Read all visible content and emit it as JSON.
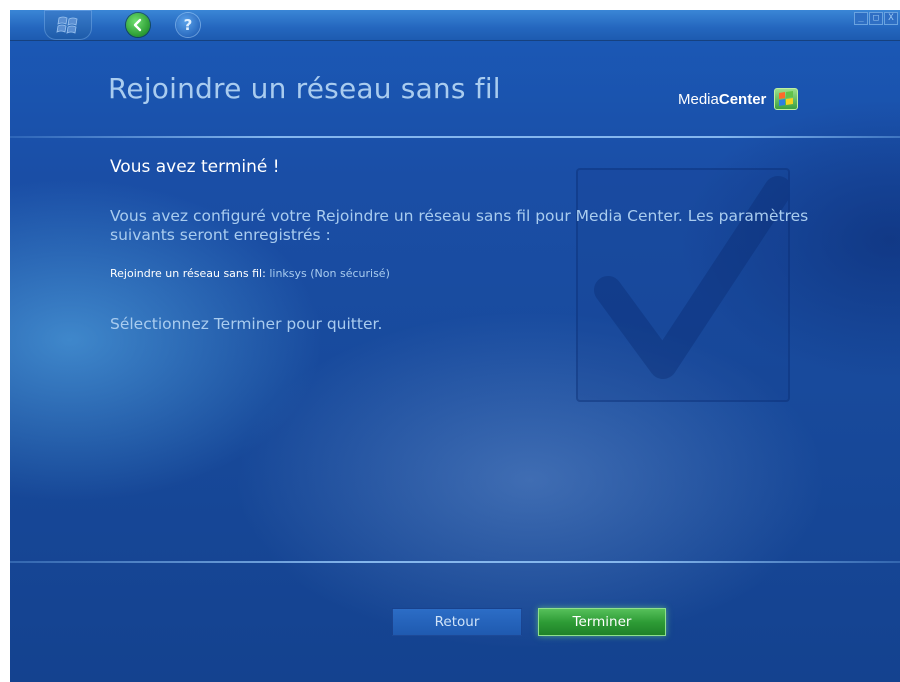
{
  "header": {
    "title": "Rejoindre un réseau sans fil",
    "logo_light": "Media",
    "logo_bold": "Center"
  },
  "topbar": {
    "help_glyph": "?",
    "controls": [
      "_",
      "□",
      "X"
    ]
  },
  "content": {
    "heading": "Vous avez terminé !",
    "description": "Vous avez configuré votre Rejoindre un réseau sans fil pour Media Center. Les paramètres suivants seront enregistrés :",
    "setting_label": "Rejoindre un réseau sans fil:",
    "setting_value": "linksys (Non sécurisé)",
    "instruction": "Sélectionnez Terminer pour quitter."
  },
  "buttons": {
    "back_label": "Retour",
    "finish_label": "Terminer"
  },
  "icons": {
    "start": "windows-flag-icon",
    "back": "back-arrow-icon",
    "help": "help-icon",
    "logo": "windows-logo-icon",
    "watermark": "checkmark-icon"
  },
  "colors": {
    "background": "#1a4ea6",
    "title_text": "#a9ccef",
    "heading_text": "#ffffff",
    "finish_button": "#2e9c36",
    "back_button": "#2c6dc6"
  }
}
